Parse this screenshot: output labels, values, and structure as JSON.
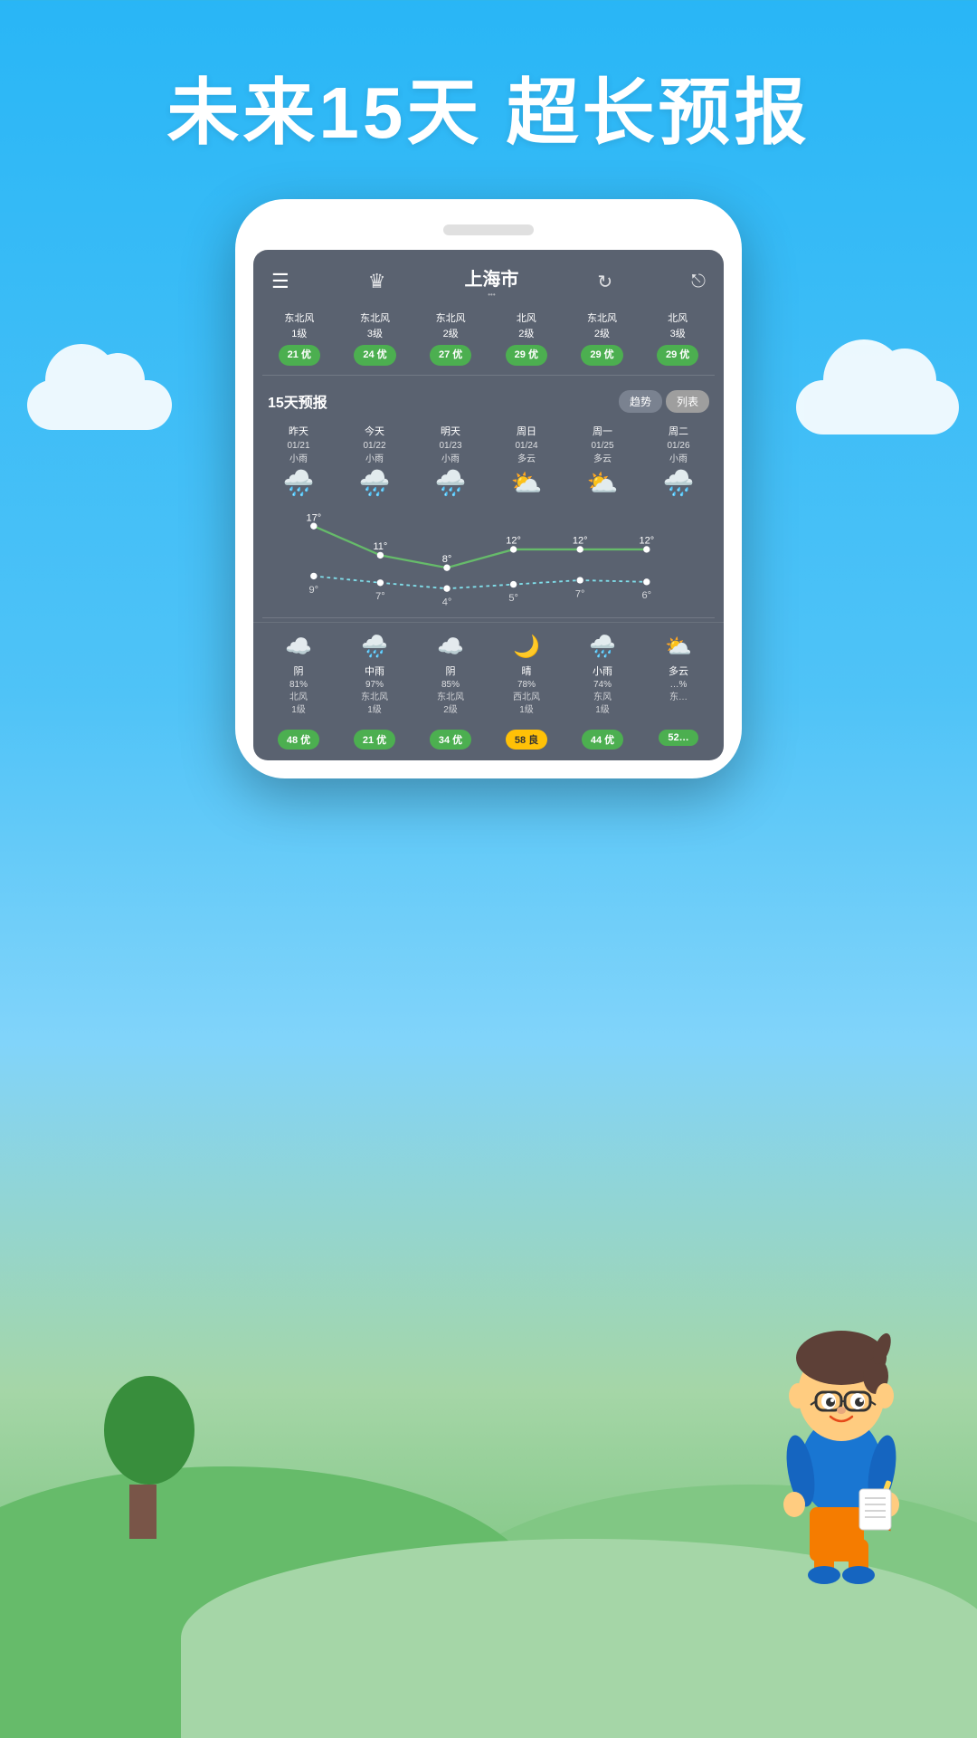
{
  "hero": {
    "title": "未来15天 超长预报"
  },
  "phone": {
    "speaker": "",
    "topbar": {
      "city": "上海市",
      "dots": "•••",
      "menu_icon": "☰",
      "crown_icon": "♛",
      "refresh_icon": "↻",
      "share_icon": "⊘"
    },
    "wind_row": [
      {
        "wind": "东北风",
        "level": "1级",
        "aqi": "21 优",
        "color": "green"
      },
      {
        "wind": "东北风",
        "level": "3级",
        "aqi": "24 优",
        "color": "green"
      },
      {
        "wind": "东北风",
        "level": "2级",
        "aqi": "27 优",
        "color": "green"
      },
      {
        "wind": "北风",
        "level": "2级",
        "aqi": "29 优",
        "color": "green"
      },
      {
        "wind": "东北风",
        "level": "2级",
        "aqi": "29 优",
        "color": "green"
      },
      {
        "wind": "北风",
        "level": "3级",
        "aqi": "29 优",
        "color": "green"
      }
    ],
    "forecast_section": {
      "title": "15天预报",
      "tabs": [
        "趋势",
        "列表"
      ],
      "active_tab": "趋势"
    },
    "forecast_days": [
      {
        "day": "昨天",
        "date": "01/21",
        "weather": "小雨",
        "icon": "🌧",
        "high": "17°",
        "low": "9°"
      },
      {
        "day": "今天",
        "date": "01/22",
        "weather": "小雨",
        "icon": "🌧",
        "high": "11°",
        "low": "7°"
      },
      {
        "day": "明天",
        "date": "01/23",
        "weather": "小雨",
        "icon": "🌧",
        "high": "8°",
        "low": "4°"
      },
      {
        "day": "周日",
        "date": "01/24",
        "weather": "多云",
        "icon": "⛅",
        "high": "12°",
        "low": "5°"
      },
      {
        "day": "周一",
        "date": "01/25",
        "weather": "多云",
        "icon": "⛅",
        "high": "12°",
        "low": "7°"
      },
      {
        "day": "周二",
        "date": "01/26",
        "weather": "小雨",
        "icon": "🌧",
        "high": "12°",
        "low": "6°"
      }
    ],
    "bottom_days": [
      {
        "icon": "☁",
        "desc": "阴",
        "rain": "81%",
        "wind": "北风\n1级",
        "aqi": "48 优",
        "aqi_color": "green"
      },
      {
        "icon": "🌧",
        "desc": "中雨",
        "rain": "97%",
        "wind": "东北风\n1级",
        "aqi": "21 优",
        "aqi_color": "green"
      },
      {
        "icon": "☁",
        "desc": "阴",
        "rain": "85%",
        "wind": "东北风\n2级",
        "aqi": "34 优",
        "aqi_color": "green"
      },
      {
        "icon": "🌙",
        "desc": "晴",
        "rain": "78%",
        "wind": "西北风\n1级",
        "aqi": "58 良",
        "aqi_color": "yellow"
      },
      {
        "icon": "🌧",
        "desc": "小雨",
        "rain": "74%",
        "wind": "东风\n1级",
        "aqi": "44 优",
        "aqi_color": "green"
      },
      {
        "icon": "⛅",
        "desc": "多云",
        "rain": "…%",
        "wind": "东…",
        "aqi": "52…",
        "aqi_color": "green"
      }
    ]
  }
}
